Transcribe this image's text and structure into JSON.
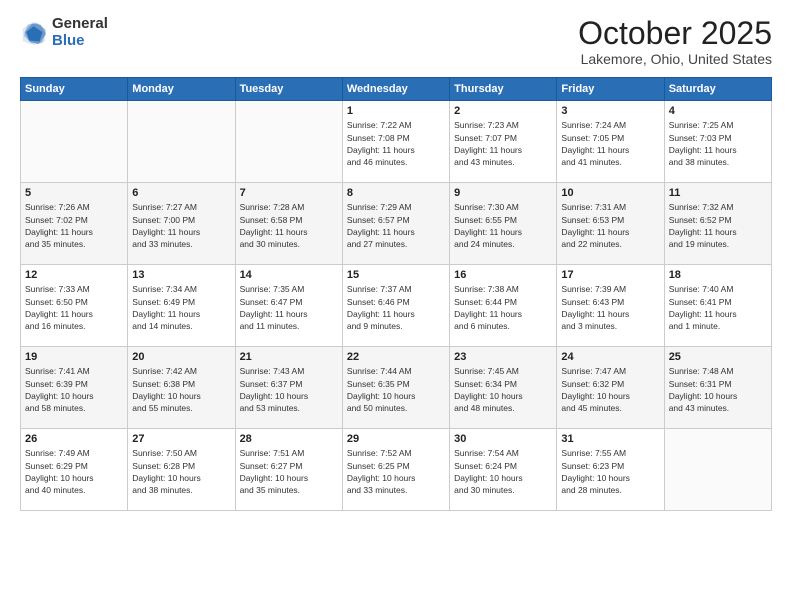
{
  "header": {
    "logo_general": "General",
    "logo_blue": "Blue",
    "title": "October 2025",
    "subtitle": "Lakemore, Ohio, United States"
  },
  "days_of_week": [
    "Sunday",
    "Monday",
    "Tuesday",
    "Wednesday",
    "Thursday",
    "Friday",
    "Saturday"
  ],
  "weeks": [
    [
      {
        "day": "",
        "info": ""
      },
      {
        "day": "",
        "info": ""
      },
      {
        "day": "",
        "info": ""
      },
      {
        "day": "1",
        "info": "Sunrise: 7:22 AM\nSunset: 7:08 PM\nDaylight: 11 hours\nand 46 minutes."
      },
      {
        "day": "2",
        "info": "Sunrise: 7:23 AM\nSunset: 7:07 PM\nDaylight: 11 hours\nand 43 minutes."
      },
      {
        "day": "3",
        "info": "Sunrise: 7:24 AM\nSunset: 7:05 PM\nDaylight: 11 hours\nand 41 minutes."
      },
      {
        "day": "4",
        "info": "Sunrise: 7:25 AM\nSunset: 7:03 PM\nDaylight: 11 hours\nand 38 minutes."
      }
    ],
    [
      {
        "day": "5",
        "info": "Sunrise: 7:26 AM\nSunset: 7:02 PM\nDaylight: 11 hours\nand 35 minutes."
      },
      {
        "day": "6",
        "info": "Sunrise: 7:27 AM\nSunset: 7:00 PM\nDaylight: 11 hours\nand 33 minutes."
      },
      {
        "day": "7",
        "info": "Sunrise: 7:28 AM\nSunset: 6:58 PM\nDaylight: 11 hours\nand 30 minutes."
      },
      {
        "day": "8",
        "info": "Sunrise: 7:29 AM\nSunset: 6:57 PM\nDaylight: 11 hours\nand 27 minutes."
      },
      {
        "day": "9",
        "info": "Sunrise: 7:30 AM\nSunset: 6:55 PM\nDaylight: 11 hours\nand 24 minutes."
      },
      {
        "day": "10",
        "info": "Sunrise: 7:31 AM\nSunset: 6:53 PM\nDaylight: 11 hours\nand 22 minutes."
      },
      {
        "day": "11",
        "info": "Sunrise: 7:32 AM\nSunset: 6:52 PM\nDaylight: 11 hours\nand 19 minutes."
      }
    ],
    [
      {
        "day": "12",
        "info": "Sunrise: 7:33 AM\nSunset: 6:50 PM\nDaylight: 11 hours\nand 16 minutes."
      },
      {
        "day": "13",
        "info": "Sunrise: 7:34 AM\nSunset: 6:49 PM\nDaylight: 11 hours\nand 14 minutes."
      },
      {
        "day": "14",
        "info": "Sunrise: 7:35 AM\nSunset: 6:47 PM\nDaylight: 11 hours\nand 11 minutes."
      },
      {
        "day": "15",
        "info": "Sunrise: 7:37 AM\nSunset: 6:46 PM\nDaylight: 11 hours\nand 9 minutes."
      },
      {
        "day": "16",
        "info": "Sunrise: 7:38 AM\nSunset: 6:44 PM\nDaylight: 11 hours\nand 6 minutes."
      },
      {
        "day": "17",
        "info": "Sunrise: 7:39 AM\nSunset: 6:43 PM\nDaylight: 11 hours\nand 3 minutes."
      },
      {
        "day": "18",
        "info": "Sunrise: 7:40 AM\nSunset: 6:41 PM\nDaylight: 11 hours\nand 1 minute."
      }
    ],
    [
      {
        "day": "19",
        "info": "Sunrise: 7:41 AM\nSunset: 6:39 PM\nDaylight: 10 hours\nand 58 minutes."
      },
      {
        "day": "20",
        "info": "Sunrise: 7:42 AM\nSunset: 6:38 PM\nDaylight: 10 hours\nand 55 minutes."
      },
      {
        "day": "21",
        "info": "Sunrise: 7:43 AM\nSunset: 6:37 PM\nDaylight: 10 hours\nand 53 minutes."
      },
      {
        "day": "22",
        "info": "Sunrise: 7:44 AM\nSunset: 6:35 PM\nDaylight: 10 hours\nand 50 minutes."
      },
      {
        "day": "23",
        "info": "Sunrise: 7:45 AM\nSunset: 6:34 PM\nDaylight: 10 hours\nand 48 minutes."
      },
      {
        "day": "24",
        "info": "Sunrise: 7:47 AM\nSunset: 6:32 PM\nDaylight: 10 hours\nand 45 minutes."
      },
      {
        "day": "25",
        "info": "Sunrise: 7:48 AM\nSunset: 6:31 PM\nDaylight: 10 hours\nand 43 minutes."
      }
    ],
    [
      {
        "day": "26",
        "info": "Sunrise: 7:49 AM\nSunset: 6:29 PM\nDaylight: 10 hours\nand 40 minutes."
      },
      {
        "day": "27",
        "info": "Sunrise: 7:50 AM\nSunset: 6:28 PM\nDaylight: 10 hours\nand 38 minutes."
      },
      {
        "day": "28",
        "info": "Sunrise: 7:51 AM\nSunset: 6:27 PM\nDaylight: 10 hours\nand 35 minutes."
      },
      {
        "day": "29",
        "info": "Sunrise: 7:52 AM\nSunset: 6:25 PM\nDaylight: 10 hours\nand 33 minutes."
      },
      {
        "day": "30",
        "info": "Sunrise: 7:54 AM\nSunset: 6:24 PM\nDaylight: 10 hours\nand 30 minutes."
      },
      {
        "day": "31",
        "info": "Sunrise: 7:55 AM\nSunset: 6:23 PM\nDaylight: 10 hours\nand 28 minutes."
      },
      {
        "day": "",
        "info": ""
      }
    ]
  ]
}
